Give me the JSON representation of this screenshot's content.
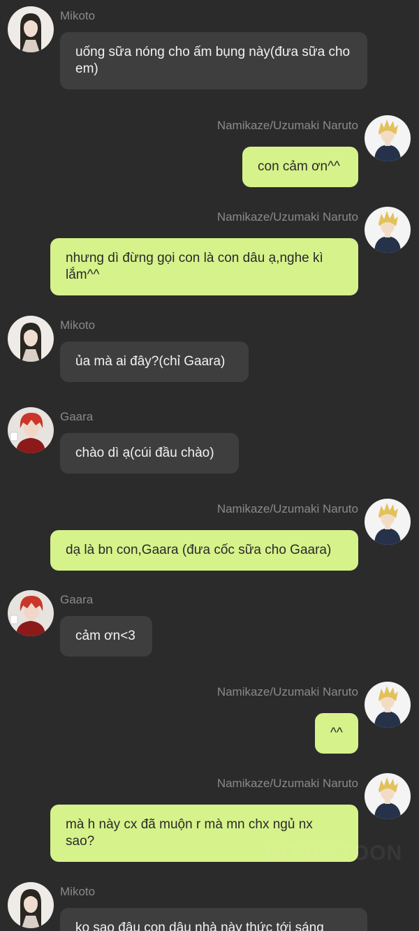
{
  "colors": {
    "background": "#2b2b2b",
    "incoming_bubble": "#3e3e3e",
    "outgoing_bubble": "#d6f28b",
    "sender_name": "#8a8a8a"
  },
  "messages": [
    {
      "sender": "Mikoto",
      "side": "left",
      "avatar": "mikoto-avatar-icon",
      "text": "uống sữa nóng cho ấm bụng này(đưa sữa cho em)"
    },
    {
      "sender": "Namikaze/Uzumaki Naruto",
      "side": "right",
      "avatar": "naruto-avatar-icon",
      "text": "con cảm ơn^^"
    },
    {
      "sender": "Namikaze/Uzumaki Naruto",
      "side": "right",
      "avatar": "naruto-avatar-icon",
      "text": "nhưng dì đừng gọi con là con dâu ạ,nghe kì lắm^^"
    },
    {
      "sender": "Mikoto",
      "side": "left",
      "avatar": "mikoto-avatar-icon",
      "text": "ủa mà ai đây?(chỉ Gaara)"
    },
    {
      "sender": "Gaara",
      "side": "left",
      "avatar": "gaara-avatar-icon",
      "text": "chào dì ạ(cúi đầu chào)"
    },
    {
      "sender": "Namikaze/Uzumaki Naruto",
      "side": "right",
      "avatar": "naruto-avatar-icon",
      "text": "dạ là bn con,Gaara (đưa cốc sữa cho Gaara)"
    },
    {
      "sender": "Gaara",
      "side": "left",
      "avatar": "gaara-avatar-icon",
      "text": "cảm ơn<3"
    },
    {
      "sender": "Namikaze/Uzumaki Naruto",
      "side": "right",
      "avatar": "naruto-avatar-icon",
      "text": "^^"
    },
    {
      "sender": "Namikaze/Uzumaki Naruto",
      "side": "right",
      "avatar": "naruto-avatar-icon",
      "text": "mà h này cx đã muộn r mà mn chx ngủ nx sao?"
    },
    {
      "sender": "Mikoto",
      "side": "left",
      "avatar": "mikoto-avatar-icon",
      "text": "ko sao đâu con dâu nhà này thức tới sáng"
    }
  ],
  "watermark": "NOVELTOON"
}
